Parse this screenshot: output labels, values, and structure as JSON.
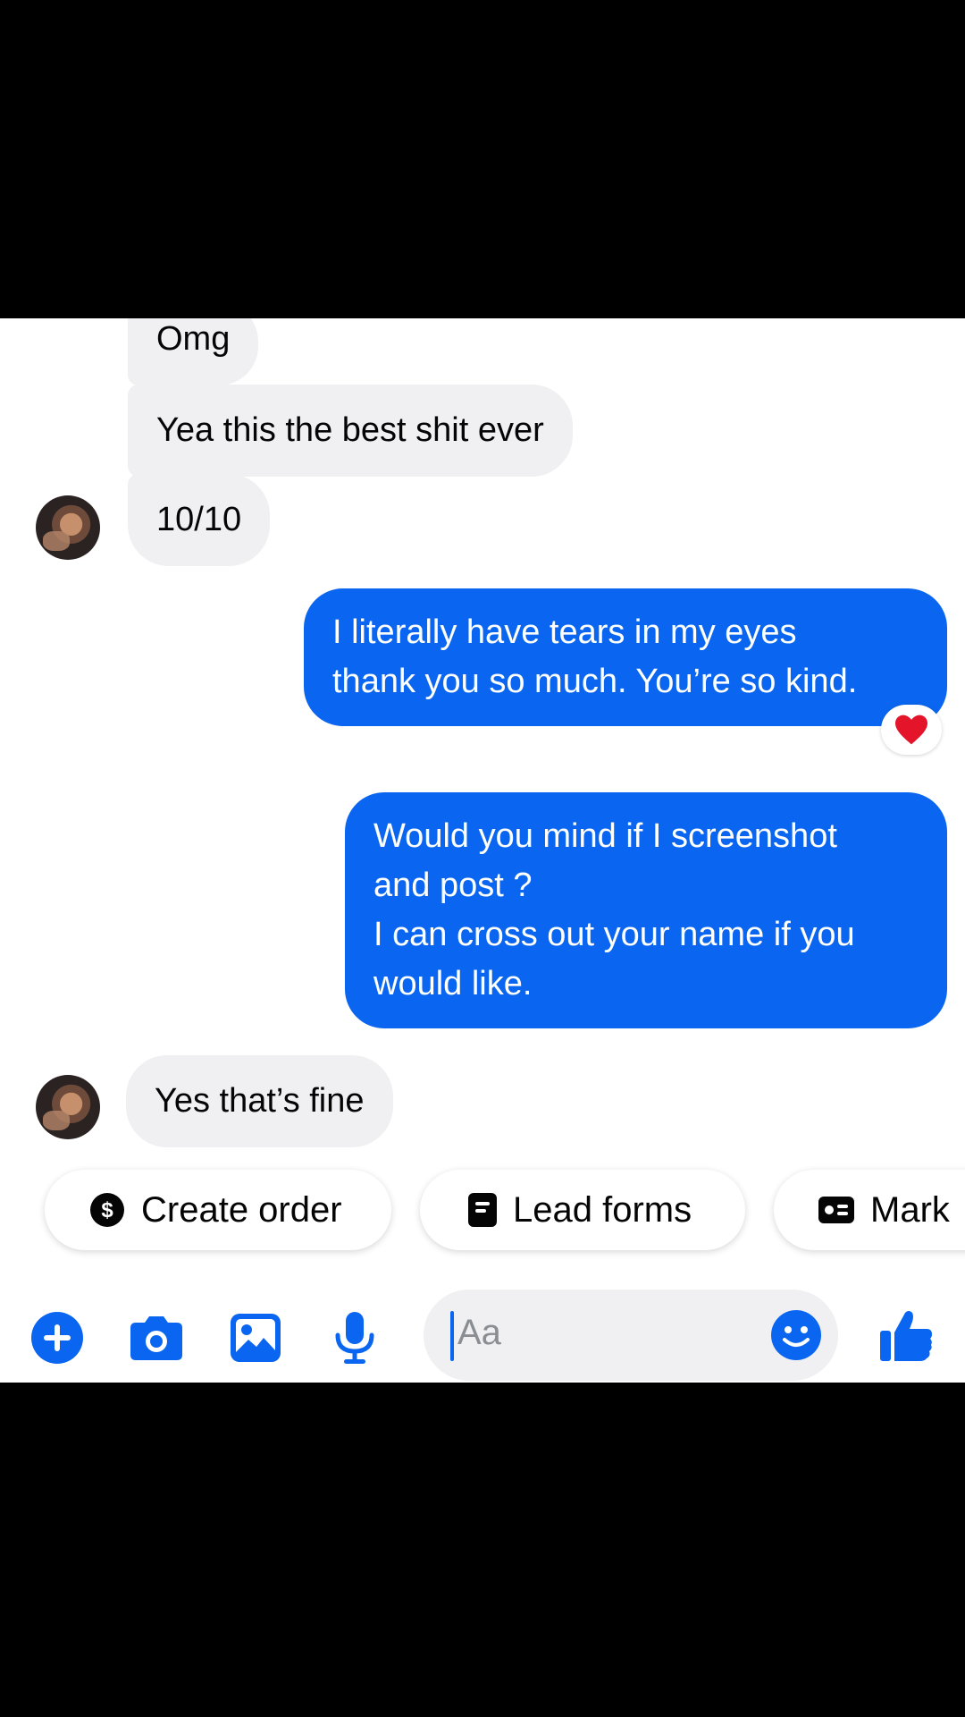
{
  "messages": {
    "incoming_1": "Omg",
    "incoming_2": "Yea this the best shit ever",
    "incoming_3": "10/10",
    "outgoing_1": {
      "line1": "I literally have tears in my eyes",
      "line2": "thank you so much. You’re so kind."
    },
    "reaction_1": "❤️",
    "outgoing_2": {
      "line1": "Would you mind if I screenshot",
      "line2": "and post ?",
      "line3": "I can cross out your name if you",
      "line4": "would like."
    },
    "incoming_4": "Yes that’s fine"
  },
  "quick_actions": [
    {
      "label": "Create order",
      "icon": "dollar-circle-icon"
    },
    {
      "label": "Lead forms",
      "icon": "form-icon"
    },
    {
      "label": "Mark",
      "icon": "card-icon"
    }
  ],
  "composer": {
    "placeholder": "Aa"
  },
  "toolbar_icons": [
    "plus-icon",
    "camera-icon",
    "image-icon",
    "microphone-icon",
    "emoji-icon",
    "thumbs-up-icon"
  ],
  "colors": {
    "accent": "#0a66f0",
    "incoming_bubble": "#f0f0f2",
    "background": "#ffffff",
    "letterbox": "#000000"
  }
}
